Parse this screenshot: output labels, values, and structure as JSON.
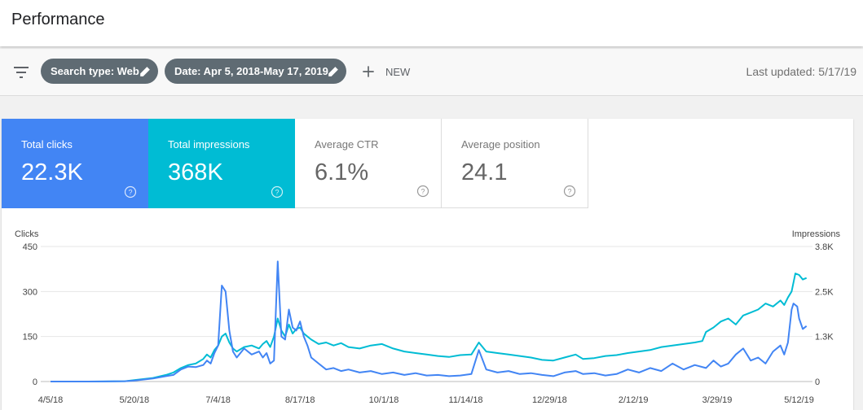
{
  "header": {
    "title": "Performance"
  },
  "toolbar": {
    "filter_icon": "filter-icon",
    "chips": [
      {
        "label": "Search type: Web",
        "icon": "pencil-icon"
      },
      {
        "label": "Date: Apr 5, 2018-May 17, 2019",
        "icon": "pencil-icon"
      }
    ],
    "new_label": "NEW",
    "last_updated": "Last updated: 5/17/19"
  },
  "metrics": [
    {
      "label": "Total clicks",
      "value": "22.3K",
      "color": "#4285f4",
      "selected": true
    },
    {
      "label": "Total impressions",
      "value": "368K",
      "color": "#00bcd4",
      "selected": true
    },
    {
      "label": "Average CTR",
      "value": "6.1%",
      "selected": false
    },
    {
      "label": "Average position",
      "value": "24.1",
      "selected": false
    }
  ],
  "chart_data": {
    "type": "line",
    "left_axis_label": "Clicks",
    "right_axis_label": "Impressions",
    "left_ticks": [
      {
        "label": "0",
        "value": 0
      },
      {
        "label": "150",
        "value": 150
      },
      {
        "label": "300",
        "value": 300
      },
      {
        "label": "450",
        "value": 450
      }
    ],
    "right_ticks": [
      {
        "label": "0",
        "value": 0
      },
      {
        "label": "1.3K",
        "value": 1267
      },
      {
        "label": "2.5K",
        "value": 2533
      },
      {
        "label": "3.8K",
        "value": 3800
      }
    ],
    "left_range": [
      0,
      450
    ],
    "right_range": [
      0,
      3800
    ],
    "x_range": [
      0,
      407
    ],
    "x_ticks": [
      {
        "label": "4/5/18",
        "day": 0
      },
      {
        "label": "5/20/18",
        "day": 45
      },
      {
        "label": "7/4/18",
        "day": 90
      },
      {
        "label": "8/17/18",
        "day": 134
      },
      {
        "label": "10/1/18",
        "day": 179
      },
      {
        "label": "11/14/18",
        "day": 223
      },
      {
        "label": "12/29/18",
        "day": 268
      },
      {
        "label": "2/12/19",
        "day": 313
      },
      {
        "label": "3/29/19",
        "day": 358
      },
      {
        "label": "5/12/19",
        "day": 402
      }
    ],
    "series": [
      {
        "name": "Clicks",
        "axis": "left",
        "color": "#4285f4",
        "points": [
          [
            0,
            0
          ],
          [
            20,
            0
          ],
          [
            40,
            1
          ],
          [
            45,
            3
          ],
          [
            55,
            10
          ],
          [
            62,
            18
          ],
          [
            66,
            22
          ],
          [
            70,
            40
          ],
          [
            74,
            50
          ],
          [
            78,
            48
          ],
          [
            82,
            55
          ],
          [
            84,
            70
          ],
          [
            86,
            60
          ],
          [
            88,
            95
          ],
          [
            90,
            120
          ],
          [
            92,
            320
          ],
          [
            94,
            300
          ],
          [
            96,
            170
          ],
          [
            98,
            100
          ],
          [
            100,
            80
          ],
          [
            104,
            110
          ],
          [
            108,
            90
          ],
          [
            112,
            100
          ],
          [
            114,
            80
          ],
          [
            116,
            95
          ],
          [
            118,
            60
          ],
          [
            120,
            70
          ],
          [
            122,
            400
          ],
          [
            124,
            150
          ],
          [
            126,
            140
          ],
          [
            128,
            240
          ],
          [
            130,
            180
          ],
          [
            132,
            170
          ],
          [
            134,
            200
          ],
          [
            136,
            150
          ],
          [
            138,
            120
          ],
          [
            140,
            80
          ],
          [
            144,
            60
          ],
          [
            148,
            40
          ],
          [
            152,
            45
          ],
          [
            156,
            35
          ],
          [
            160,
            40
          ],
          [
            166,
            30
          ],
          [
            172,
            35
          ],
          [
            178,
            25
          ],
          [
            184,
            30
          ],
          [
            190,
            22
          ],
          [
            196,
            28
          ],
          [
            202,
            20
          ],
          [
            208,
            22
          ],
          [
            214,
            18
          ],
          [
            220,
            20
          ],
          [
            226,
            25
          ],
          [
            230,
            105
          ],
          [
            234,
            40
          ],
          [
            240,
            30
          ],
          [
            246,
            35
          ],
          [
            252,
            25
          ],
          [
            258,
            28
          ],
          [
            264,
            22
          ],
          [
            270,
            18
          ],
          [
            276,
            30
          ],
          [
            282,
            35
          ],
          [
            286,
            25
          ],
          [
            292,
            28
          ],
          [
            298,
            20
          ],
          [
            304,
            25
          ],
          [
            310,
            40
          ],
          [
            316,
            30
          ],
          [
            322,
            45
          ],
          [
            328,
            35
          ],
          [
            334,
            60
          ],
          [
            340,
            40
          ],
          [
            346,
            55
          ],
          [
            352,
            45
          ],
          [
            356,
            70
          ],
          [
            360,
            50
          ],
          [
            364,
            60
          ],
          [
            368,
            90
          ],
          [
            372,
            110
          ],
          [
            376,
            70
          ],
          [
            380,
            80
          ],
          [
            384,
            60
          ],
          [
            388,
            100
          ],
          [
            392,
            120
          ],
          [
            394,
            90
          ],
          [
            396,
            130
          ],
          [
            398,
            240
          ],
          [
            399,
            260
          ],
          [
            401,
            250
          ],
          [
            402,
            210
          ],
          [
            404,
            175
          ],
          [
            406,
            185
          ]
        ]
      },
      {
        "name": "Impressions",
        "axis": "left",
        "color": "#00bcd4",
        "points": [
          [
            0,
            0
          ],
          [
            20,
            0
          ],
          [
            40,
            1
          ],
          [
            45,
            5
          ],
          [
            55,
            12
          ],
          [
            62,
            22
          ],
          [
            66,
            30
          ],
          [
            70,
            45
          ],
          [
            74,
            55
          ],
          [
            78,
            60
          ],
          [
            82,
            75
          ],
          [
            84,
            90
          ],
          [
            86,
            80
          ],
          [
            88,
            105
          ],
          [
            90,
            120
          ],
          [
            92,
            150
          ],
          [
            94,
            160
          ],
          [
            96,
            130
          ],
          [
            98,
            110
          ],
          [
            100,
            100
          ],
          [
            104,
            115
          ],
          [
            108,
            120
          ],
          [
            112,
            110
          ],
          [
            114,
            125
          ],
          [
            116,
            135
          ],
          [
            118,
            115
          ],
          [
            120,
            150
          ],
          [
            122,
            210
          ],
          [
            124,
            170
          ],
          [
            126,
            150
          ],
          [
            128,
            190
          ],
          [
            130,
            160
          ],
          [
            132,
            175
          ],
          [
            134,
            180
          ],
          [
            136,
            160
          ],
          [
            138,
            150
          ],
          [
            140,
            140
          ],
          [
            144,
            125
          ],
          [
            148,
            130
          ],
          [
            152,
            120
          ],
          [
            156,
            128
          ],
          [
            160,
            115
          ],
          [
            166,
            110
          ],
          [
            172,
            120
          ],
          [
            178,
            125
          ],
          [
            184,
            110
          ],
          [
            190,
            100
          ],
          [
            196,
            95
          ],
          [
            202,
            90
          ],
          [
            208,
            85
          ],
          [
            214,
            82
          ],
          [
            220,
            88
          ],
          [
            226,
            90
          ],
          [
            230,
            130
          ],
          [
            234,
            100
          ],
          [
            240,
            95
          ],
          [
            246,
            90
          ],
          [
            252,
            85
          ],
          [
            258,
            80
          ],
          [
            264,
            72
          ],
          [
            270,
            70
          ],
          [
            276,
            80
          ],
          [
            282,
            90
          ],
          [
            286,
            75
          ],
          [
            292,
            78
          ],
          [
            298,
            85
          ],
          [
            304,
            88
          ],
          [
            310,
            95
          ],
          [
            316,
            100
          ],
          [
            322,
            105
          ],
          [
            328,
            115
          ],
          [
            334,
            120
          ],
          [
            340,
            125
          ],
          [
            346,
            130
          ],
          [
            350,
            135
          ],
          [
            352,
            165
          ],
          [
            356,
            180
          ],
          [
            360,
            200
          ],
          [
            364,
            210
          ],
          [
            368,
            190
          ],
          [
            372,
            220
          ],
          [
            376,
            230
          ],
          [
            380,
            240
          ],
          [
            384,
            260
          ],
          [
            388,
            250
          ],
          [
            392,
            270
          ],
          [
            394,
            255
          ],
          [
            396,
            280
          ],
          [
            398,
            300
          ],
          [
            400,
            360
          ],
          [
            402,
            355
          ],
          [
            404,
            340
          ],
          [
            406,
            345
          ]
        ]
      }
    ]
  }
}
